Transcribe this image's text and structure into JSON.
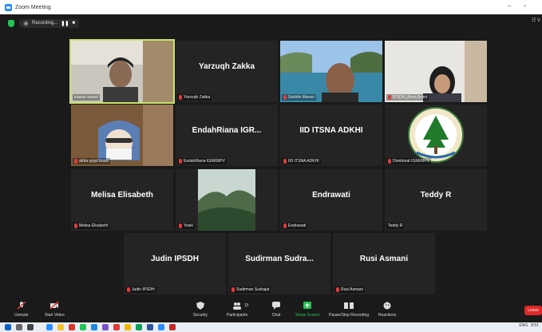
{
  "window": {
    "title": "Zoom Meeting"
  },
  "recording": {
    "label": "Recording..."
  },
  "toolbar": {
    "unmute": "Unmute",
    "start_video": "Start Video",
    "security": "Security",
    "participants": "Participants",
    "participant_count": "15",
    "chat": "Chat",
    "share_screen": "Share Screen",
    "pause_stop_recording": "Pause/Stop Recording",
    "reactions": "Reactions",
    "leave": "Leave"
  },
  "participants": [
    {
      "label": "irawan asaad",
      "big_name": "",
      "type": "video"
    },
    {
      "label": "Yarzuqh Zakka",
      "big_name": "Yarzuqh Zakka",
      "type": "name"
    },
    {
      "label": "Sokhlin Manuri",
      "big_name": "",
      "type": "video"
    },
    {
      "label": "IPSDH_Anna Ikrimi",
      "big_name": "",
      "type": "video"
    },
    {
      "label": "afrita syiyd bussi",
      "big_name": "",
      "type": "video"
    },
    {
      "label": "EndahRiana IGRKMPV",
      "big_name": "EndahRiana IGR...",
      "type": "name"
    },
    {
      "label": "IID ITSNA ADKHI",
      "big_name": "IID ITSNA ADKHI",
      "type": "name"
    },
    {
      "label": "Direktorat IGRKMPV",
      "big_name": "",
      "type": "logo"
    },
    {
      "label": "Melisa Elisabeth",
      "big_name": "Melisa Elisabeth",
      "type": "name"
    },
    {
      "label": "Yoski",
      "big_name": "",
      "type": "video"
    },
    {
      "label": "Endrawati",
      "big_name": "Endrawati",
      "type": "name"
    },
    {
      "label": "Teddy R",
      "big_name": "Teddy R",
      "type": "name"
    },
    {
      "label": "Judin IPSDH",
      "big_name": "Judin IPSDH",
      "type": "name"
    },
    {
      "label": "Sudirman Sudrajat",
      "big_name": "Sudirman Sudra...",
      "type": "name"
    },
    {
      "label": "Rusi Asmani",
      "big_name": "Rusi Asmani",
      "type": "name"
    }
  ],
  "taskbar": {
    "language": "ENG",
    "time": "8:51"
  },
  "colors": {
    "active_speaker": "#c8e36b",
    "leave": "#e02828",
    "share": "#23c552",
    "muted": "#e03b3b"
  }
}
